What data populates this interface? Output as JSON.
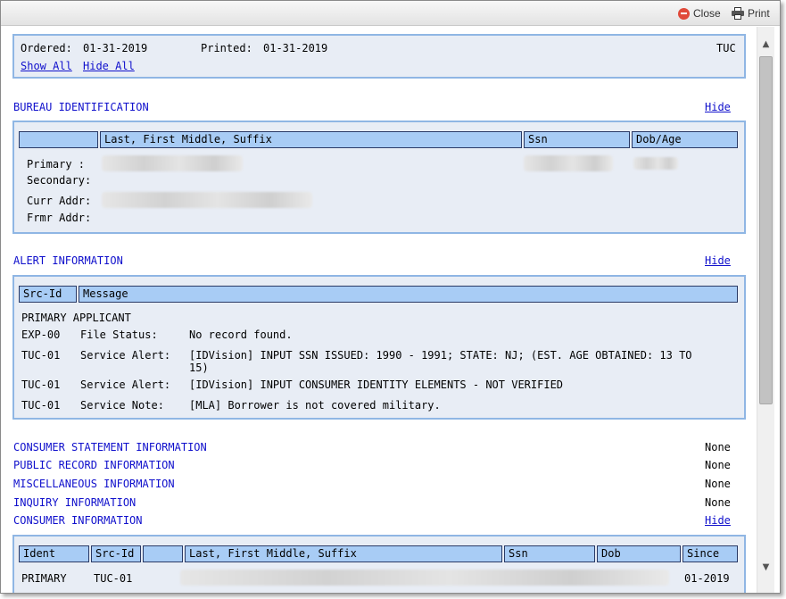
{
  "toolbar": {
    "close_label": "Close",
    "print_label": "Print"
  },
  "header": {
    "ordered_label": "Ordered:",
    "ordered_date": "01-31-2019",
    "printed_label": "Printed:",
    "printed_date": "01-31-2019",
    "bureau": "TUC",
    "show_all": "Show All",
    "hide_all": "Hide All"
  },
  "bureau_identification": {
    "title": "BUREAU IDENTIFICATION",
    "hide": "Hide",
    "columns": [
      "",
      "Last, First Middle, Suffix",
      "Ssn",
      "Dob/Age"
    ],
    "rows": {
      "primary": "Primary   :",
      "secondary": "Secondary:",
      "curr_addr": "Curr Addr:",
      "frmr_addr": "Frmr Addr:"
    }
  },
  "alert_information": {
    "title": "ALERT INFORMATION",
    "hide": "Hide",
    "columns": [
      "Src-Id",
      "Message"
    ],
    "group_label": "PRIMARY APPLICANT",
    "rows": [
      {
        "src": "EXP-00",
        "type": "File Status:",
        "message": "No record found."
      },
      {
        "src": "TUC-01",
        "type": "Service Alert:",
        "message": "[IDVision] INPUT SSN ISSUED: 1990 - 1991; STATE: NJ; (EST. AGE OBTAINED: 13 TO",
        "message_cont": "15)"
      },
      {
        "src": "TUC-01",
        "type": "Service Alert:",
        "message": "[IDVision] INPUT CONSUMER IDENTITY ELEMENTS - NOT VERIFIED"
      },
      {
        "src": "TUC-01",
        "type": "Service Note:",
        "message": "[MLA] Borrower is not covered military."
      }
    ]
  },
  "sections": [
    {
      "title": "CONSUMER STATEMENT INFORMATION",
      "status": "None"
    },
    {
      "title": "PUBLIC RECORD INFORMATION",
      "status": "None"
    },
    {
      "title": "MISCELLANEOUS INFORMATION",
      "status": "None"
    },
    {
      "title": "INQUIRY INFORMATION",
      "status": "None"
    }
  ],
  "consumer_information": {
    "title": "CONSUMER INFORMATION",
    "hide": "Hide",
    "columns": [
      "Ident",
      "Src-Id",
      "",
      "Last, First Middle, Suffix",
      "Ssn",
      "Dob",
      "Since"
    ],
    "rows": [
      {
        "ident": "PRIMARY",
        "src": "TUC-01",
        "since": "01-2019"
      }
    ]
  },
  "icons": {
    "close": "close-icon",
    "print": "printer-icon",
    "scroll_up": "chevron-up-icon",
    "scroll_down": "chevron-down-icon"
  },
  "colors": {
    "link": "#1010cc",
    "panel_bg": "#e8edf5",
    "panel_border": "#8fb6e4",
    "header_cell": "#a8ccf5"
  }
}
